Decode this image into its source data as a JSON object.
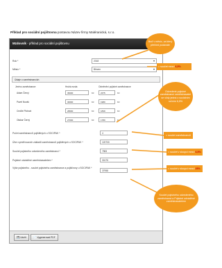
{
  "page": {
    "title_bold": "Příklad pro sociální pojištovna",
    "title_rest": " postavou Název firmy Maléranická, s.r.o."
  },
  "window": {
    "title_bold": "Mzdovník",
    "title_rest": " - příklad pro sociální pojištovnu"
  },
  "fields": {
    "rok_label": "Rok *",
    "rok_value": "2018",
    "mesic_label": "Měsíc *",
    "mesic_value": "Březen"
  },
  "section": {
    "label": "Údaje o zaměstnancích"
  },
  "table": {
    "headers": [
      "Jméno zaměstnance",
      "Hrubá mzda",
      "Odměnění pojistné zaměstnance"
    ],
    "rows": [
      {
        "name": "Adam Černý",
        "gross": "36000",
        "unit": "Kč",
        "insurance": "2375",
        "ins_unit": "Kč"
      },
      {
        "name": "Pavel Novák",
        "gross": "30000",
        "unit": "Kč",
        "insurance": "1980",
        "ins_unit": "Kč"
      },
      {
        "name": "Cecilie Plotová",
        "gross": "28000",
        "unit": "Kč",
        "insurance": "1839",
        "ins_unit": "Kč"
      },
      {
        "name": "Otakar Černý",
        "gross": "27000",
        "unit": "Kč",
        "insurance": "1780",
        "ins_unit": "Kč"
      }
    ]
  },
  "summary": [
    {
      "label": "Počet zaměstnanců pojištěných u SOCIPAK *",
      "value": "4"
    },
    {
      "label": "Úhrn vyměřovacích základů zaměstnanců pojištěných u SOCIPAK *",
      "value": "120700"
    },
    {
      "label": "Součet pojistného odvedeného zaměstnanci *",
      "value": "7983"
    },
    {
      "label": "Pojistné odváděné zaměstnavatelem *",
      "value": "30175"
    },
    {
      "label": "Výše pojistného - součet pojistného zaměstnance a pojišťovny u SOCIPAK *",
      "value": "37958"
    }
  ],
  "footer": {
    "save": "Uložit",
    "pdf": "Vygenerovat PDF"
  },
  "callouts": {
    "c1": "Buď v měsíc, za který přehled podáváte",
    "c2_text": "= součet mezd ",
    "c2_em": "6,5%",
    "c3": "Odvedené pojistné zaměstnanci zaměstnavatel se vždy jedná o sociálním ročním 6,5%",
    "c4": "= součet zaměstnanců",
    "c5_text": "= součet v sloupci mezd ",
    "c5_em": "6,5%",
    "c6_text": "= součet v sloupci mezd ",
    "c6_em": "25%",
    "c7": "Součet pojistného odvedeného zaměstnanci a Pojistné odváděné zaměstnavatelem"
  },
  "colors": {
    "accent": "#f39a1e",
    "emphasis": "#c00000",
    "header": "#1c1c1c"
  }
}
